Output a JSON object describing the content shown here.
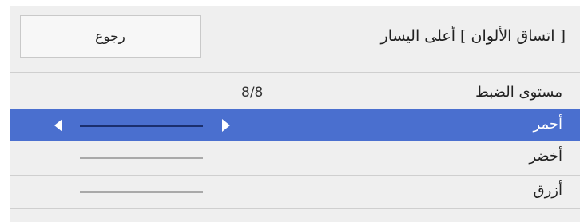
{
  "header": {
    "title": "[ اتساق الألوان ] أعلى اليسار",
    "back_label": "رجوع"
  },
  "rows": [
    {
      "label": "مستوى الضبط",
      "value": "8/8"
    },
    {
      "label": "أحمر",
      "selected": true,
      "level": 1.0
    },
    {
      "label": "أخضر",
      "level": 1.0
    },
    {
      "label": "أزرق",
      "level": 1.0
    }
  ],
  "colors": {
    "background": "#efefef",
    "selected_row": "#4a6fcf",
    "divider": "#cfcfcf",
    "track": "#a9a9a9",
    "selected_track": "#1b2f6e"
  },
  "icons": [
    "left-arrow-icon",
    "right-arrow-icon"
  ]
}
